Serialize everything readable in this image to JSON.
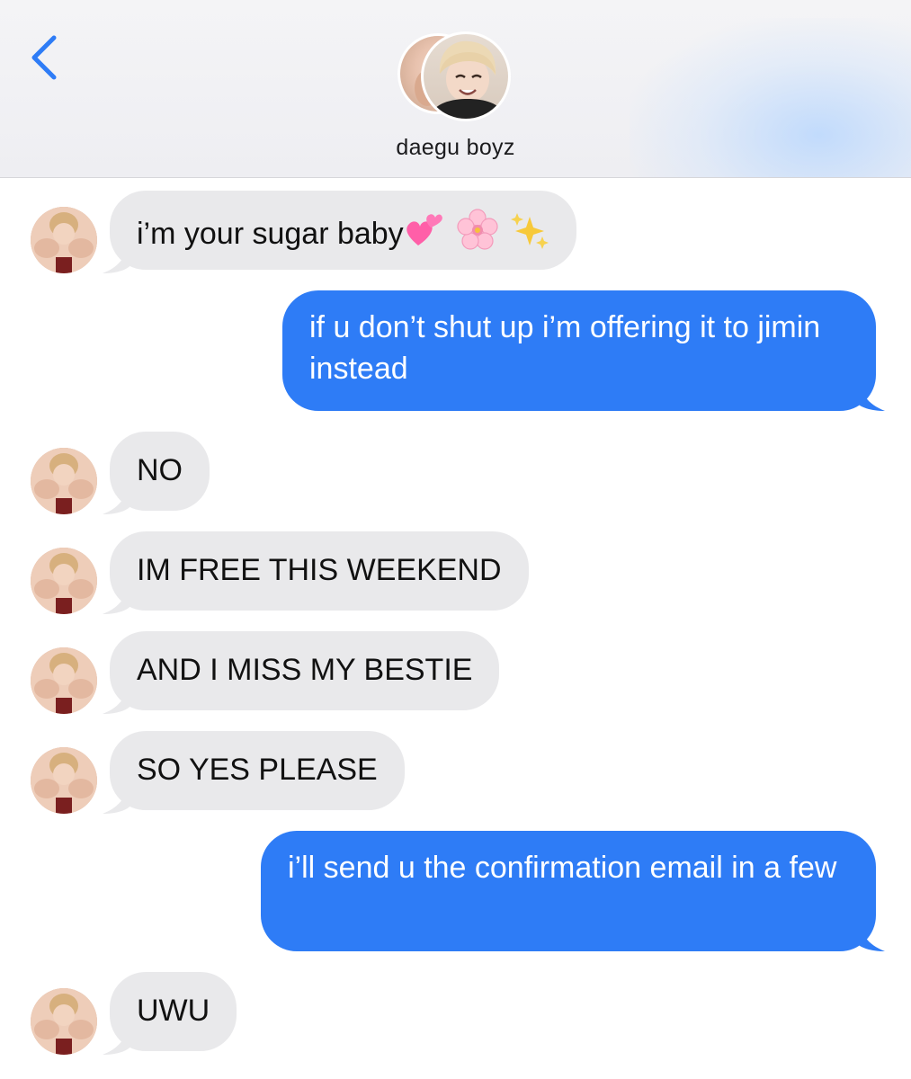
{
  "header": {
    "title": "daegu boyz",
    "back_icon": "chevron-left-icon",
    "accent": "#2e7cf6"
  },
  "messages": [
    {
      "direction": "incoming",
      "text": "i’m your sugar baby",
      "emoji": [
        "two-hearts-emoji",
        "cherry-blossom-emoji",
        "sparkles-emoji"
      ]
    },
    {
      "direction": "outgoing",
      "text": "if u don’t shut up i’m offering it to jimin instead"
    },
    {
      "direction": "incoming",
      "text": "NO"
    },
    {
      "direction": "incoming",
      "text": "IM FREE THIS WEEKEND"
    },
    {
      "direction": "incoming",
      "text": "AND I MISS MY BESTIE"
    },
    {
      "direction": "incoming",
      "text": "SO YES PLEASE"
    },
    {
      "direction": "outgoing",
      "text": "i’ll send u the confirmation email in a few"
    },
    {
      "direction": "incoming",
      "text": "UWU"
    }
  ],
  "colors": {
    "incoming_bubble": "#e9e9eb",
    "outgoing_bubble": "#2e7cf6",
    "header_bg": "#f4f4f6"
  }
}
